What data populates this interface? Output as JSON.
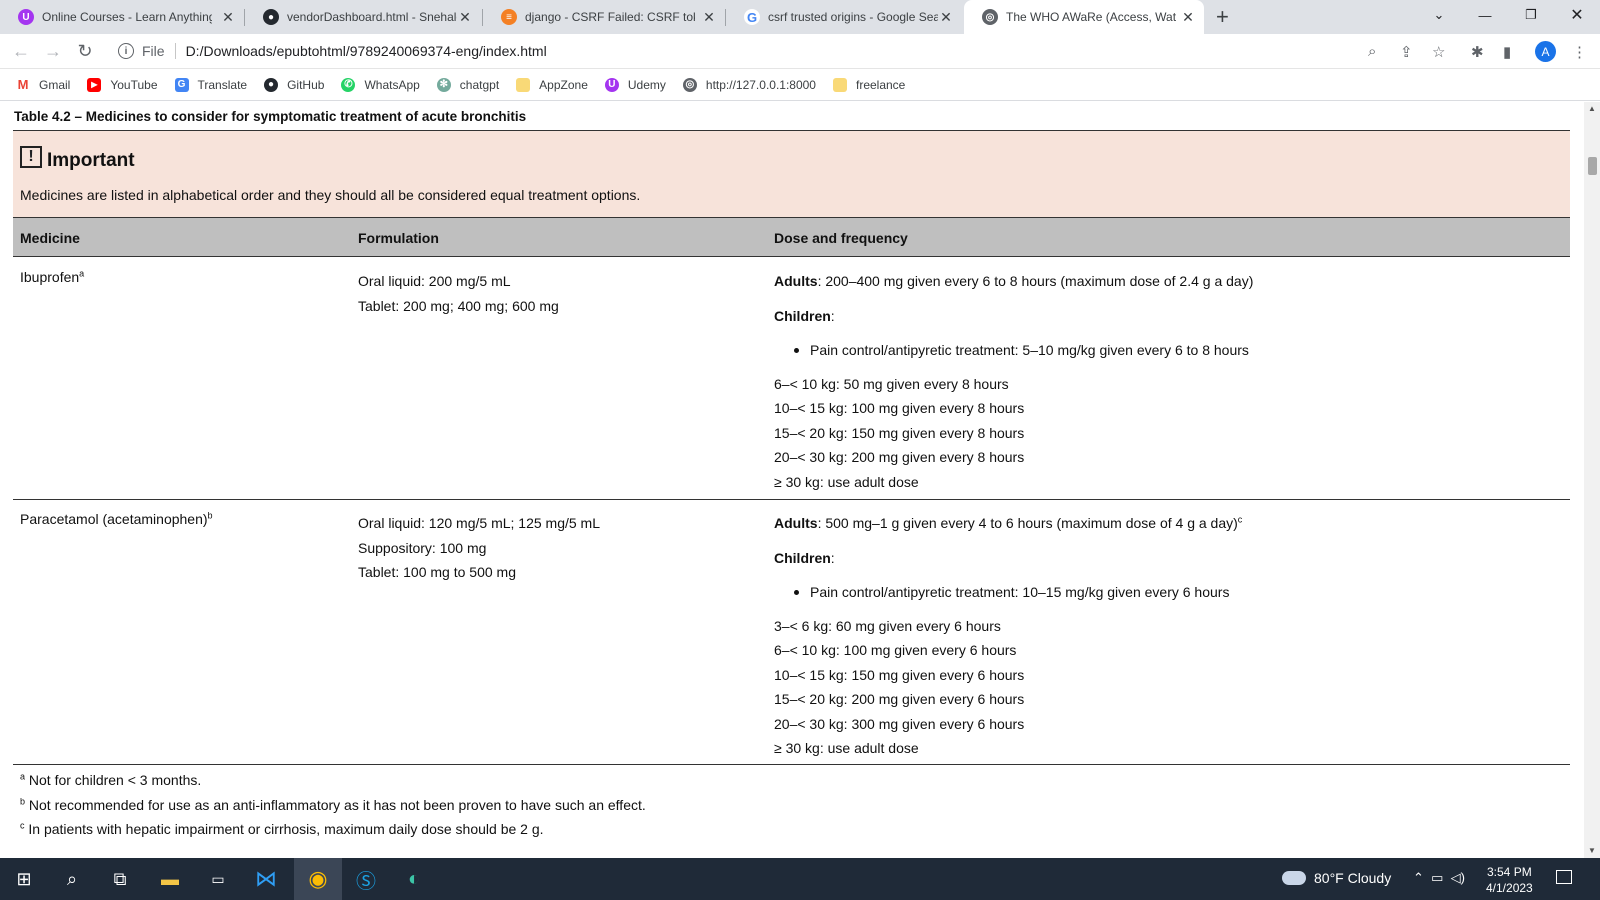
{
  "browser": {
    "tabs": [
      {
        "title": "Online Courses - Learn Anything",
        "icon": "udemy-icon",
        "color": "#a435f0"
      },
      {
        "title": "vendorDashboard.html - Snehald",
        "icon": "github-icon",
        "color": "#24292f"
      },
      {
        "title": "django - CSRF Failed: CSRF token",
        "icon": "stackoverflow-icon",
        "color": "#f48024"
      },
      {
        "title": "csrf trusted origins - Google Sear",
        "icon": "google-icon",
        "color": "#4285f4"
      },
      {
        "title": "The WHO AWaRe (Access, Watch",
        "icon": "globe-icon",
        "color": "#5f6368",
        "active": true
      }
    ],
    "address": {
      "scheme_label": "File",
      "url": "D:/Downloads/epubtohtml/9789240069374-eng/index.html"
    },
    "profile_initial": "A",
    "bookmarks": [
      {
        "label": "Gmail",
        "icon": "gmail-icon",
        "color": "#ea4335"
      },
      {
        "label": "YouTube",
        "icon": "youtube-icon",
        "color": "#ff0000"
      },
      {
        "label": "Translate",
        "icon": "translate-icon",
        "color": "#4285f4"
      },
      {
        "label": "GitHub",
        "icon": "github-icon",
        "color": "#24292f"
      },
      {
        "label": "WhatsApp",
        "icon": "whatsapp-icon",
        "color": "#25d366"
      },
      {
        "label": "chatgpt",
        "icon": "chatgpt-icon",
        "color": "#74aa9c"
      },
      {
        "label": "AppZone",
        "icon": "folder-icon",
        "color": "#f9d977"
      },
      {
        "label": "Udemy",
        "icon": "udemy-icon",
        "color": "#a435f0"
      },
      {
        "label": "http://127.0.0.1:8000",
        "icon": "globe-icon",
        "color": "#5f6368"
      },
      {
        "label": "freelance",
        "icon": "folder-icon",
        "color": "#f9d977"
      }
    ]
  },
  "page": {
    "caption": "Table 4.2 – Medicines to consider for symptomatic treatment of acute bronchitis",
    "important": {
      "title": "Important",
      "text": "Medicines are listed in alphabetical order and they should all be considered equal treatment options."
    },
    "headers": {
      "medicine": "Medicine",
      "formulation": "Formulation",
      "dose": "Dose and frequency"
    },
    "rows": [
      {
        "medicine": "Ibuprofen",
        "medicine_sup": "a",
        "formulations": [
          "Oral liquid: 200 mg/5 mL",
          "Tablet: 200 mg; 400 mg; 600 mg"
        ],
        "adults_label": "Adults",
        "adults_text": ": 200–400 mg given every 6 to 8 hours (maximum dose of 2.4 g a day)",
        "adults_sup": "",
        "children_label": "Children",
        "children_bullet": "Pain control/antipyretic treatment: 5–10 mg/kg given every 6 to 8 hours",
        "weights": [
          "6–< 10 kg: 50 mg given every 8 hours",
          "10–< 15 kg: 100 mg given every 8 hours",
          "15–< 20 kg: 150 mg given every 8 hours",
          "20–< 30 kg: 200 mg given every 8 hours",
          "≥ 30 kg: use adult dose"
        ]
      },
      {
        "medicine": "Paracetamol (acetaminophen)",
        "medicine_sup": "b",
        "formulations": [
          "Oral liquid: 120 mg/5 mL; 125 mg/5 mL",
          "Suppository: 100 mg",
          "Tablet: 100 mg to 500 mg"
        ],
        "adults_label": "Adults",
        "adults_text": ": 500 mg–1 g given every 4 to 6 hours (maximum dose of 4 g a day)",
        "adults_sup": "c",
        "children_label": "Children",
        "children_bullet": "Pain control/antipyretic treatment: 10–15 mg/kg given every 6 hours",
        "weights": [
          "3–< 6 kg: 60 mg given every 6 hours",
          "6–< 10 kg: 100 mg given every 6 hours",
          "10–< 15 kg: 150 mg given every 6 hours",
          "15–< 20 kg: 200 mg given every 6 hours",
          "20–< 30 kg: 300 mg given every 6 hours",
          "≥ 30 kg: use adult dose"
        ]
      }
    ],
    "footnotes": [
      {
        "mark": "a",
        "text": " Not for children < 3 months."
      },
      {
        "mark": "b",
        "text": " Not recommended for use as an anti-inflammatory as it has not been proven to have such an effect."
      },
      {
        "mark": "c",
        "text": " In patients with hepatic impairment or cirrhosis, maximum daily dose should be 2 g."
      }
    ]
  },
  "taskbar": {
    "weather": "80°F Cloudy",
    "time": "3:54 PM",
    "date": "4/1/2023"
  }
}
